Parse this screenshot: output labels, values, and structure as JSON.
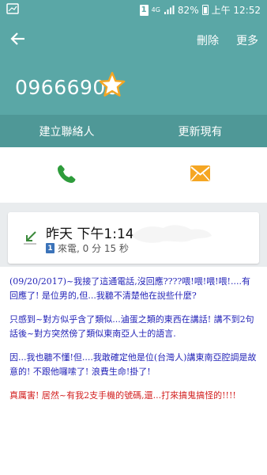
{
  "status_bar": {
    "sim": "1",
    "network": "4G",
    "battery_percent": "82%",
    "time": "上午 12:52",
    "battery_level": 0.82,
    "icons": [
      "notification-icon",
      "sim-icon",
      "signal-icon",
      "battery-icon"
    ]
  },
  "header": {
    "phone_number": "09666906",
    "delete_label": "刪除",
    "more_label": "更多",
    "icons": [
      "back-arrow-icon",
      "star-icon"
    ],
    "star_color": "#f5a623"
  },
  "actions": {
    "create_contact": "建立聯絡人",
    "update_existing": "更新現有"
  },
  "comm": {
    "call_icon": "phone-icon",
    "call_color": "#2e9c3b",
    "message_icon": "envelope-icon",
    "message_color": "#f5a623"
  },
  "call_log": {
    "time": "昨天 下午1:14",
    "sim": "1",
    "detail": "來電, 0 分 15 秒",
    "icon": "incoming-call-icon"
  },
  "note": {
    "paragraph1": "(09/20/2017)~我接了這通電話,沒回應????喂!喂!喂!喂!....有回應了! 是位男的,但...我聽不清楚他在說些什麼?",
    "paragraph2": "只感到~對方似乎含了類似...滷蛋之類的東西在講話! 講不到2句話後~對方突然傍了類似東南亞人士的語言.",
    "paragraph3": "因...我也聽不懂!但....我敢確定他是位(台灣人)講東南亞腔調是故意的! 不跟他囉嗦了! 浪費生命!掛了!",
    "paragraph4": "真厲害! 居然~有我2支手機的號碼,還...打來搞鬼搞怪的!!!!"
  },
  "colors": {
    "header_bg": "#5aa7a6",
    "action_bg": "#4f9897",
    "note_blue": "#2424b8",
    "note_red": "#d21e1e"
  }
}
